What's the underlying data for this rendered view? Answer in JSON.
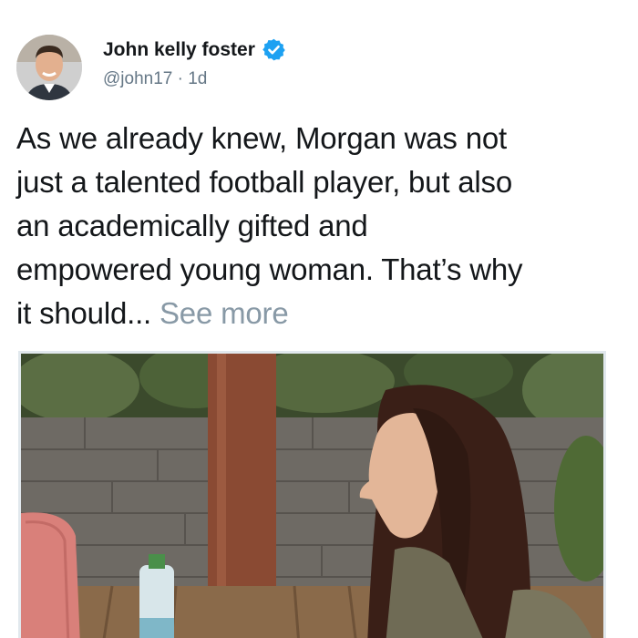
{
  "author": {
    "display_name": "John kelly foster",
    "handle": "@john17",
    "separator": "·",
    "time": "1d",
    "verified_icon": "verified-badge-icon",
    "avatar_icon": "profile-photo"
  },
  "tweet": {
    "lines": [
      "As we already knew, Morgan was not",
      "just a talented football player, but also",
      "an academically gifted and",
      "empowered young woman. That’s why",
      "it should..."
    ],
    "see_more": "See more"
  },
  "media": {
    "description_icon": "attached-photo"
  },
  "colors": {
    "text": "#14171a",
    "secondary": "#657786",
    "see_more": "#8899a6",
    "verified": "#1da1f2"
  }
}
